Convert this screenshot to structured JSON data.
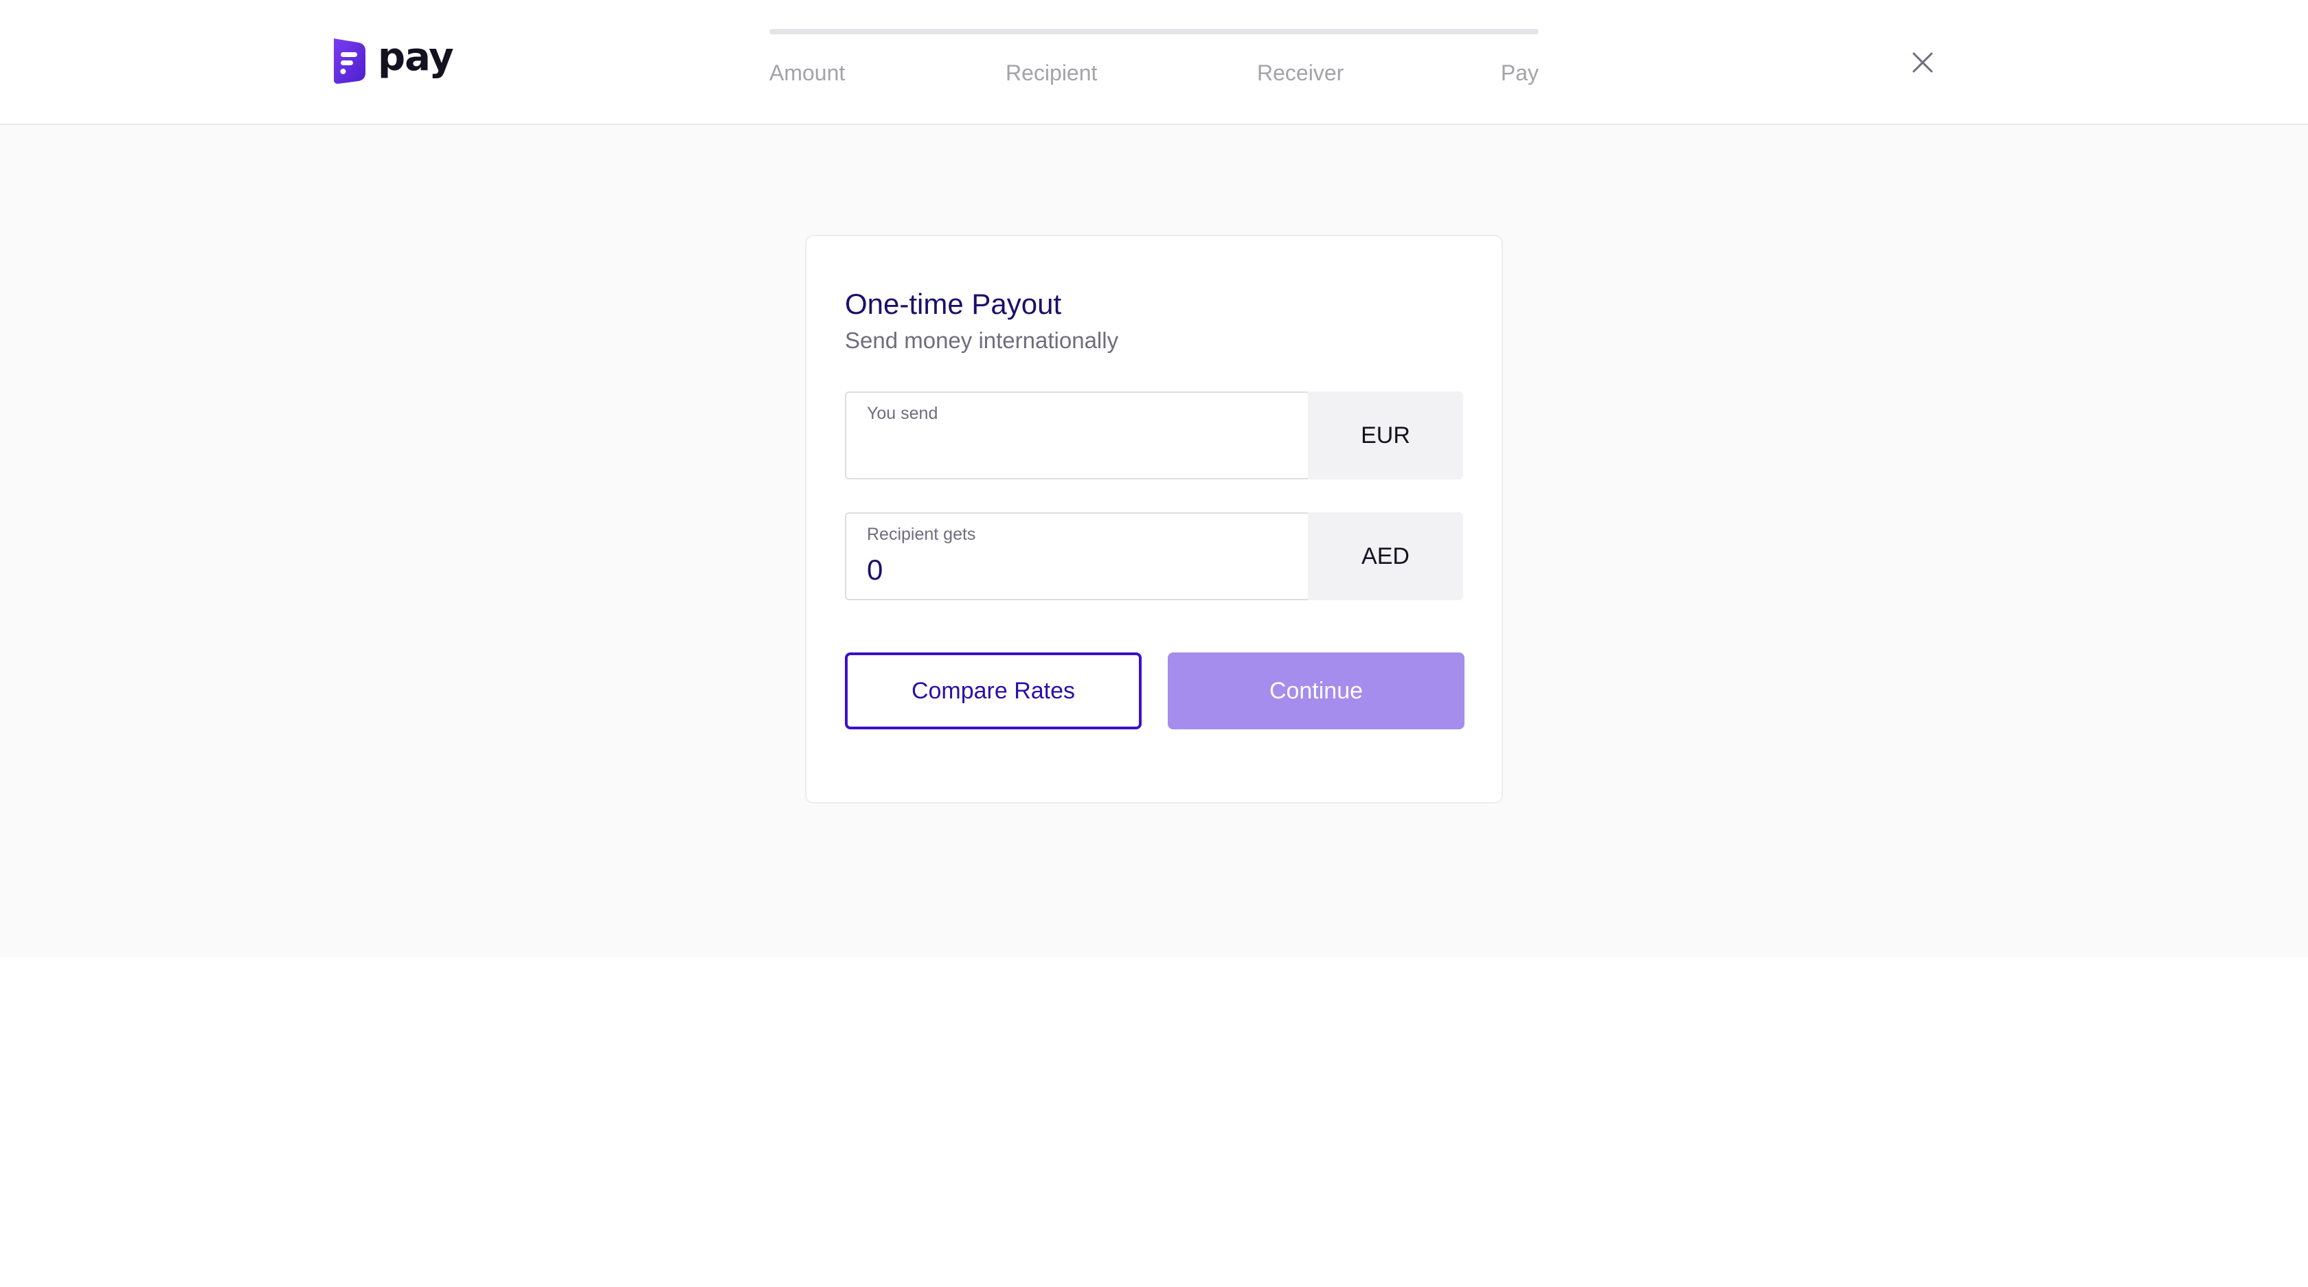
{
  "header": {
    "logo_text": "pay",
    "brand_color": "#5b2ee0",
    "progress": 0.0,
    "steps": [
      {
        "label": "Amount"
      },
      {
        "label": "Recipient"
      },
      {
        "label": "Receiver"
      },
      {
        "label": "Pay"
      }
    ],
    "close_icon": "close-icon"
  },
  "card": {
    "title": "One-time Payout",
    "subtitle": "Send money internationally",
    "send": {
      "label": "You send",
      "value": "",
      "currency": "EUR"
    },
    "gets": {
      "label": "Recipient gets",
      "value": "0",
      "currency": "AED"
    },
    "compare_label": "Compare Rates",
    "continue_label": "Continue"
  }
}
